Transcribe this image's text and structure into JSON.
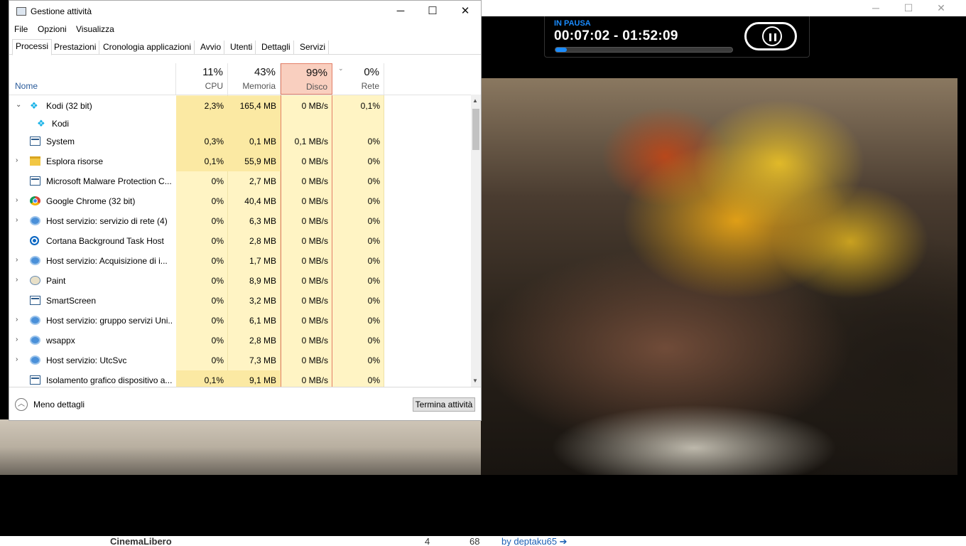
{
  "task_manager": {
    "title": "Gestione attività",
    "window_controls": {
      "minimize": "─",
      "maximize": "☐",
      "close": "✕"
    },
    "menu": [
      "File",
      "Opzioni",
      "Visualizza"
    ],
    "tabs": [
      "Processi",
      "Prestazioni",
      "Cronologia applicazioni",
      "Avvio",
      "Utenti",
      "Dettagli",
      "Servizi"
    ],
    "active_tab": "Processi",
    "columns": {
      "name": "Nome",
      "cpu": {
        "pct": "11%",
        "label": "CPU"
      },
      "memory": {
        "pct": "43%",
        "label": "Memoria"
      },
      "disk": {
        "pct": "99%",
        "label": "Disco"
      },
      "network": {
        "pct": "0%",
        "label": "Rete"
      }
    },
    "sorted_column": "disk",
    "processes": [
      {
        "name": "Kodi (32 bit)",
        "icon": "kodi-icon",
        "expander": "⌄",
        "cpu": "2,3%",
        "mem": "165,4 MB",
        "disk": "0 MB/s",
        "net": "0,1%"
      },
      {
        "name": "Kodi",
        "icon": "kodi-icon",
        "expander": "",
        "cpu": "",
        "mem": "",
        "disk": "",
        "net": "",
        "child": true
      },
      {
        "name": "System",
        "icon": "window-icon",
        "expander": "",
        "cpu": "0,3%",
        "mem": "0,1 MB",
        "disk": "0,1 MB/s",
        "net": "0%"
      },
      {
        "name": "Esplora risorse",
        "icon": "folder-icon",
        "expander": "›",
        "cpu": "0,1%",
        "mem": "55,9 MB",
        "disk": "0 MB/s",
        "net": "0%"
      },
      {
        "name": "Microsoft Malware Protection C...",
        "icon": "window-icon",
        "expander": "",
        "cpu": "0%",
        "mem": "2,7 MB",
        "disk": "0 MB/s",
        "net": "0%"
      },
      {
        "name": "Google Chrome (32 bit)",
        "icon": "chrome-icon",
        "expander": "›",
        "cpu": "0%",
        "mem": "40,4 MB",
        "disk": "0 MB/s",
        "net": "0%"
      },
      {
        "name": "Host servizio: servizio di rete (4)",
        "icon": "gear-icon",
        "expander": "›",
        "cpu": "0%",
        "mem": "6,3 MB",
        "disk": "0 MB/s",
        "net": "0%"
      },
      {
        "name": "Cortana Background Task Host",
        "icon": "cortana-icon",
        "expander": "",
        "cpu": "0%",
        "mem": "2,8 MB",
        "disk": "0 MB/s",
        "net": "0%"
      },
      {
        "name": "Host servizio: Acquisizione di i...",
        "icon": "gear-icon",
        "expander": "›",
        "cpu": "0%",
        "mem": "1,7 MB",
        "disk": "0 MB/s",
        "net": "0%"
      },
      {
        "name": "Paint",
        "icon": "paint-icon",
        "expander": "›",
        "cpu": "0%",
        "mem": "8,9 MB",
        "disk": "0 MB/s",
        "net": "0%"
      },
      {
        "name": "SmartScreen",
        "icon": "window-icon",
        "expander": "",
        "cpu": "0%",
        "mem": "3,2 MB",
        "disk": "0 MB/s",
        "net": "0%"
      },
      {
        "name": "Host servizio: gruppo servizi Uni...",
        "icon": "gear-icon",
        "expander": "›",
        "cpu": "0%",
        "mem": "6,1 MB",
        "disk": "0 MB/s",
        "net": "0%"
      },
      {
        "name": "wsappx",
        "icon": "gear-icon",
        "expander": "›",
        "cpu": "0%",
        "mem": "2,8 MB",
        "disk": "0 MB/s",
        "net": "0%"
      },
      {
        "name": "Host servizio: UtcSvc",
        "icon": "gear-icon",
        "expander": "›",
        "cpu": "0%",
        "mem": "7,3 MB",
        "disk": "0 MB/s",
        "net": "0%"
      },
      {
        "name": "Isolamento grafico dispositivo a...",
        "icon": "window-icon",
        "expander": "",
        "cpu": "0,1%",
        "mem": "9,1 MB",
        "disk": "0 MB/s",
        "net": "0%"
      }
    ],
    "footer": {
      "less_details": "Meno dettagli",
      "end_task": "Termina attività"
    }
  },
  "kodi": {
    "status": "IN PAUSA",
    "time": "00:07:02 - 01:52:09",
    "progress_fraction": 0.063,
    "accent": "#1a8cff"
  },
  "bottom_strip": {
    "text1": "CinemaLibero",
    "text2": "4",
    "text3": "68",
    "text4": "by deptaku65 ➔"
  },
  "colors": {
    "cpu_high": "#fbe9a3",
    "col_light": "#fff4c4",
    "sorted_header": "#f9cfbf"
  }
}
